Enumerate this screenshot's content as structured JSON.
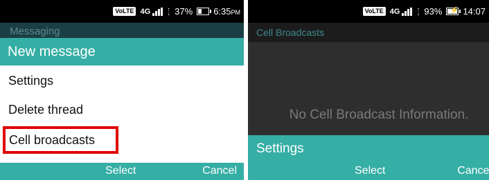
{
  "left": {
    "status": {
      "network_tag": "VoLTE",
      "network": "4G",
      "battery": "37%",
      "time": "6:35",
      "time_suffix": "PM"
    },
    "background_title": "Messaging",
    "menu": {
      "header": "New message",
      "items": [
        "Settings",
        "Delete thread",
        "Cell broadcasts"
      ],
      "highlighted_index": 2
    },
    "softkeys": {
      "center": "Select",
      "right": "Cancel"
    }
  },
  "right": {
    "status": {
      "network_tag": "VoLTE",
      "network": "4G",
      "battery": "93%",
      "time": "14:07"
    },
    "title": "Cell Broadcasts",
    "empty_message": "No Cell Broadcast Information.",
    "menu": {
      "header": "Settings"
    },
    "softkeys": {
      "center": "Select",
      "right": "Cancel"
    }
  },
  "colors": {
    "accent": "#35aea5",
    "highlight_border": "#e00000",
    "status_bar": "#000000"
  },
  "icons": [
    "volte-badge",
    "signal-icon",
    "data-arrows-icon",
    "battery-icon",
    "battery-charging-icon"
  ]
}
